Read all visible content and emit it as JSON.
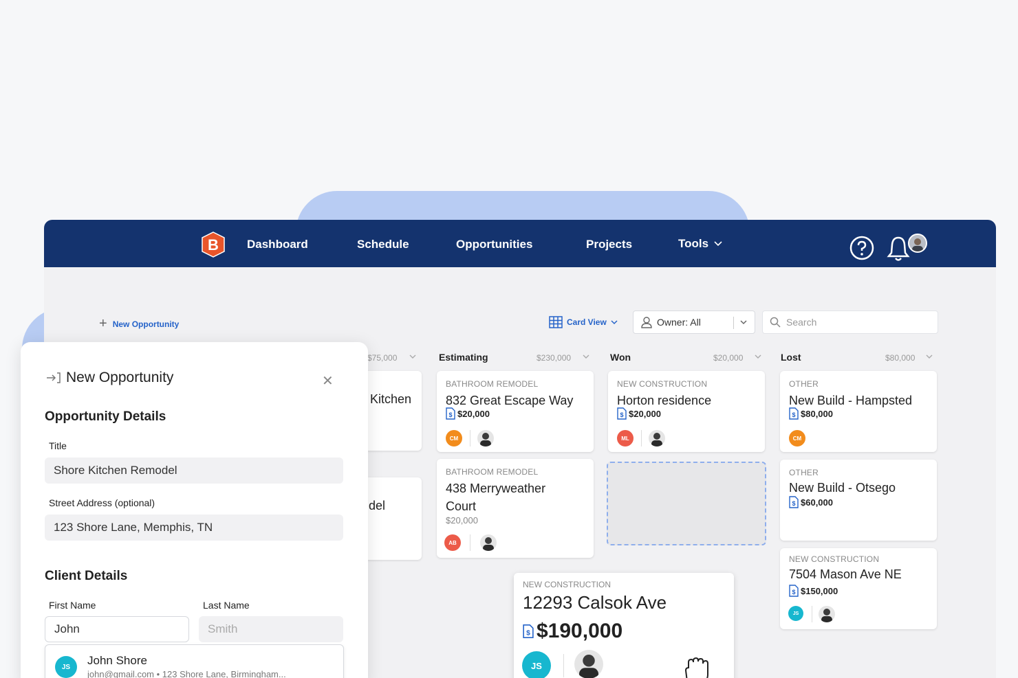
{
  "nav": {
    "items": [
      "Dashboard",
      "Schedule",
      "Opportunities",
      "Projects",
      "Tools"
    ],
    "logo_letter": "B"
  },
  "toolbar": {
    "new_label": "New Opportunity",
    "view_label": "Card View",
    "owner_label": "Owner: All",
    "search_placeholder": "Search"
  },
  "columns": [
    {
      "name": "",
      "total": "$75,000"
    },
    {
      "name": "Estimating",
      "total": "$230,000"
    },
    {
      "name": "Won",
      "total": "$20,000"
    },
    {
      "name": "Lost",
      "total": "$80,000"
    }
  ],
  "partial_cards": [
    {
      "title_fragment": "Kitchen"
    },
    {
      "title_fragment": "del"
    }
  ],
  "cards": {
    "est1": {
      "category": "BATHROOM REMODEL",
      "title": "832 Great Escape Way",
      "amount": "$20,000",
      "initials": "CM",
      "color": "#f28c1c"
    },
    "est2": {
      "category": "BATHROOM REMODEL",
      "title": "438 Merryweather",
      "title2": "Court",
      "amount": "$20,000",
      "initials": "AB",
      "color": "#ec5b49"
    },
    "won1": {
      "category": "NEW CONSTRUCTION",
      "title": "Horton residence",
      "amount": "$20,000",
      "initials": "ML",
      "color": "#ec5b49"
    },
    "lost1": {
      "category": "OTHER",
      "title": "New Build - Hampsted",
      "amount": "$80,000",
      "initials": "CM",
      "color": "#f28c1c"
    },
    "lost2": {
      "category": "OTHER",
      "title": "New Build - Otsego",
      "amount": "$60,000"
    },
    "lost3": {
      "category": "NEW CONSTRUCTION",
      "title": "7504 Mason Ave NE",
      "amount": "$150,000",
      "initials": "JS",
      "color": "#17b7cf"
    },
    "dragging": {
      "category": "NEW CONSTRUCTION",
      "title": "12293 Calsok Ave",
      "amount": "$190,000",
      "initials": "JS",
      "color": "#17b7cf"
    }
  },
  "panel": {
    "title": "New Opportunity",
    "section_opportunity": "Opportunity Details",
    "title_label": "Title",
    "title_value": "Shore Kitchen Remodel",
    "address_label": "Street Address (optional)",
    "address_value": "123 Shore Lane, Memphis, TN",
    "section_client": "Client Details",
    "first_label": "First Name",
    "first_value": "John",
    "last_label": "Last Name",
    "last_placeholder": "Smith",
    "suggestion": {
      "initials": "JS",
      "name": "John Shore",
      "meta": "john@gmail.com  •  123 Shore Lane, Birmingham..."
    }
  },
  "colors": {
    "nav": "#14336e",
    "accent": "#2563c9",
    "logo": "#e8552a"
  }
}
